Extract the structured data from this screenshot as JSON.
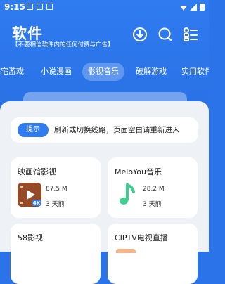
{
  "status_bar": {
    "time": "9:15"
  },
  "header": {
    "title": "软件",
    "subtitle": "【不要相信软件内的任何付费与广告】",
    "icons": [
      "download-icon",
      "search-icon",
      "menu-list-icon"
    ]
  },
  "tabs": [
    {
      "label": "宅宅游戏"
    },
    {
      "label": "小说漫画"
    },
    {
      "label": "影视音乐",
      "active": true
    },
    {
      "label": "破解游戏"
    },
    {
      "label": "实用软件"
    }
  ],
  "notice": {
    "tag": "提示",
    "message": "刷新或切换线路，页面空白请重新进入"
  },
  "apps": [
    {
      "name": "映画馆影视",
      "size": "87.5 M",
      "date": "3 天前",
      "icon": "film-4k-icon"
    },
    {
      "name": "MeloYou音乐",
      "size": "28.2 M",
      "date": "3 天前",
      "icon": "music-note-icon"
    },
    {
      "name": "58影视",
      "size": "",
      "date": "",
      "icon": ""
    },
    {
      "name": "CIPTV电视直播",
      "size": "",
      "date": "",
      "icon": ""
    }
  ],
  "colors": {
    "primary": "#2f7bf0",
    "panel": "#eef1f6",
    "music_green": "#3ecf8e"
  }
}
